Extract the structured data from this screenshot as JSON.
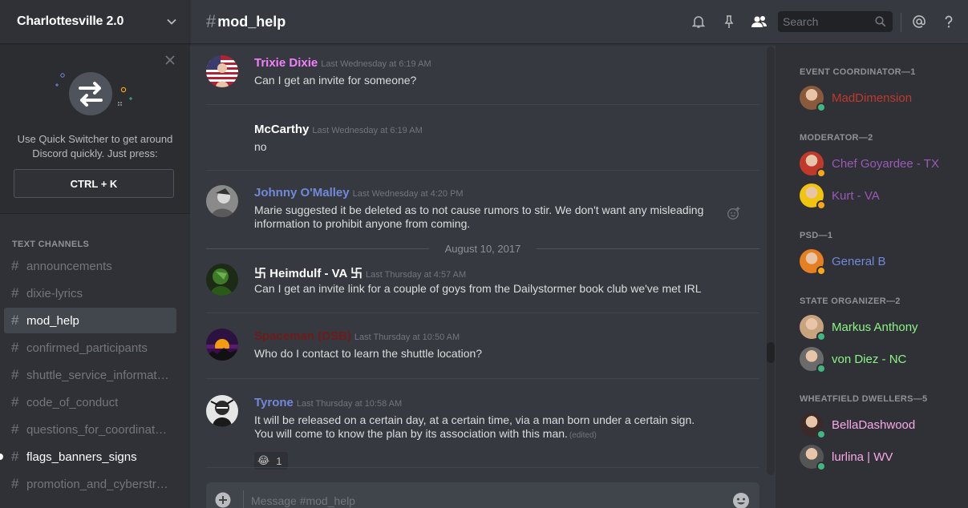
{
  "server": {
    "name": "Charlottesville 2.0"
  },
  "quick_switcher": {
    "text": "Use Quick Switcher to get around Discord quickly. Just press:",
    "shortcut": "CTRL + K"
  },
  "channels": {
    "header": "TEXT CHANNELS",
    "items": [
      {
        "name": "announcements",
        "state": "normal"
      },
      {
        "name": "dixie-lyrics",
        "state": "normal"
      },
      {
        "name": "mod_help",
        "state": "active"
      },
      {
        "name": "confirmed_participants",
        "state": "normal"
      },
      {
        "name": "shuttle_service_information",
        "state": "normal"
      },
      {
        "name": "code_of_conduct",
        "state": "normal"
      },
      {
        "name": "questions_for_coordinators",
        "state": "normal"
      },
      {
        "name": "flags_banners_signs",
        "state": "unread"
      },
      {
        "name": "promotion_and_cyberstrategy",
        "state": "normal"
      }
    ]
  },
  "chat_header": {
    "hash": "#",
    "channel": "mod_help",
    "search_placeholder": "Search",
    "icons": [
      "bell-icon",
      "pin-icon",
      "members-icon",
      "search-icon",
      "mention-icon",
      "help-icon"
    ]
  },
  "messages": [
    {
      "author": "Trixie Dixie",
      "color": "#f47fff",
      "time": "Last Wednesday at 6:19 AM",
      "lines": [
        "Can I get an invite for someone?"
      ],
      "avatar": "flag"
    },
    {
      "author": "McCarthy",
      "color": "#ffffff",
      "time": "Last Wednesday at 6:19 AM",
      "lines": [
        "no"
      ],
      "avatar": "none"
    },
    {
      "author": "Johnny O'Malley",
      "color": "#7289da",
      "time": "Last Wednesday at 4:20 PM",
      "lines": [
        "Marie suggested it be deleted as to not cause rumors to stir.  We don't want any misleading",
        "information to prohibit anyone from coming."
      ],
      "avatar": "gray"
    },
    {
      "author": "卐 Heimdulf - VA 卐",
      "color": "#ffffff",
      "time": "Last Thursday at 4:57 AM",
      "lines": [
        "Can I get an invite link for a couple of goys from the Dailystormer book club we've met IRL"
      ],
      "avatar": "green"
    },
    {
      "author": "Spaceman (DSB)",
      "color": "#6e1b1b",
      "time": "Last Thursday at 10:50 AM",
      "lines": [
        "Who do I contact to learn the shuttle location?"
      ],
      "avatar": "purple"
    },
    {
      "author": "Tyrone",
      "color": "#7289da",
      "time": "Last Thursday at 10:58 AM",
      "lines": [
        "It will be released on a certain day, at a certain time, via a man born under a certain sign.",
        "You will come to know the plan by its association with this man."
      ],
      "edited": "(edited)",
      "avatar": "mono",
      "reaction": {
        "emoji": "😂",
        "count": "1"
      }
    }
  ],
  "date_divider": "August 10, 2017",
  "composer": {
    "placeholder": "Message #mod_help"
  },
  "members": {
    "groups": [
      {
        "title": "EVENT COORDINATOR—1",
        "members": [
          {
            "name": "MadDimension",
            "color": "#c0392b",
            "status": "#43b581"
          }
        ]
      },
      {
        "title": "MODERATOR—2",
        "members": [
          {
            "name": "Chef Goyardee - TX",
            "color": "#9b59b6",
            "status": "#faa61a"
          },
          {
            "name": "Kurt - VA",
            "color": "#9b59b6",
            "status": "#faa61a"
          }
        ]
      },
      {
        "title": "PSD—1",
        "members": [
          {
            "name": "General B",
            "color": "#7289da",
            "status": "#faa61a"
          }
        ]
      },
      {
        "title": "STATE ORGANIZER—2",
        "members": [
          {
            "name": "Markus Anthony",
            "color": "#8cf585",
            "status": "#43b581"
          },
          {
            "name": "von Diez - NC",
            "color": "#8cf585",
            "status": "#43b581"
          }
        ]
      },
      {
        "title": "WHEATFIELD DWELLERS—5",
        "members": [
          {
            "name": "BellaDashwood",
            "color": "#f9a8e8",
            "status": "#43b581"
          },
          {
            "name": "lurlina | WV",
            "color": "#f9a8e8",
            "status": "#43b581"
          }
        ]
      }
    ]
  },
  "colors": {
    "background": "#36393f",
    "sidebar": "#2f3136",
    "online": "#43b581",
    "idle": "#faa61a"
  }
}
